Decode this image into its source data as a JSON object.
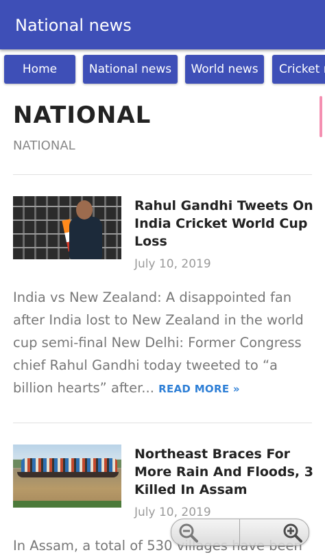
{
  "app_bar": {
    "title": "National news"
  },
  "nav": {
    "items": [
      "Home",
      "National news",
      "World news",
      "Cricket n"
    ]
  },
  "page": {
    "heading": "NATIONAL",
    "subheading": "NATIONAL"
  },
  "articles": [
    {
      "title": "Rahul Gandhi Tweets On India Cricket World Cup Loss",
      "date": "July 10, 2019",
      "excerpt": "India vs New Zealand: A disappointed fan after India lost to New Zealand in the world cup semi-final New Delhi:  Former Congress chief Rahul Gandhi today tweeted to “a billion hearts” after...",
      "read_more": "READ MORE »"
    },
    {
      "title": "Northeast Braces For More Rain And Floods, 3 Killed In Assam",
      "date": "July 10, 2019",
      "excerpt": "In Assam, a total of 530 villages have been"
    }
  ],
  "icons": {
    "zoom_out": "zoom-out-icon",
    "zoom_in": "zoom-in-icon"
  },
  "colors": {
    "app_bar": "#3e4fb7",
    "nav_button": "#3e4fb7",
    "read_more": "#2e7fd6",
    "scroll_indicator": "#f48fb1"
  }
}
